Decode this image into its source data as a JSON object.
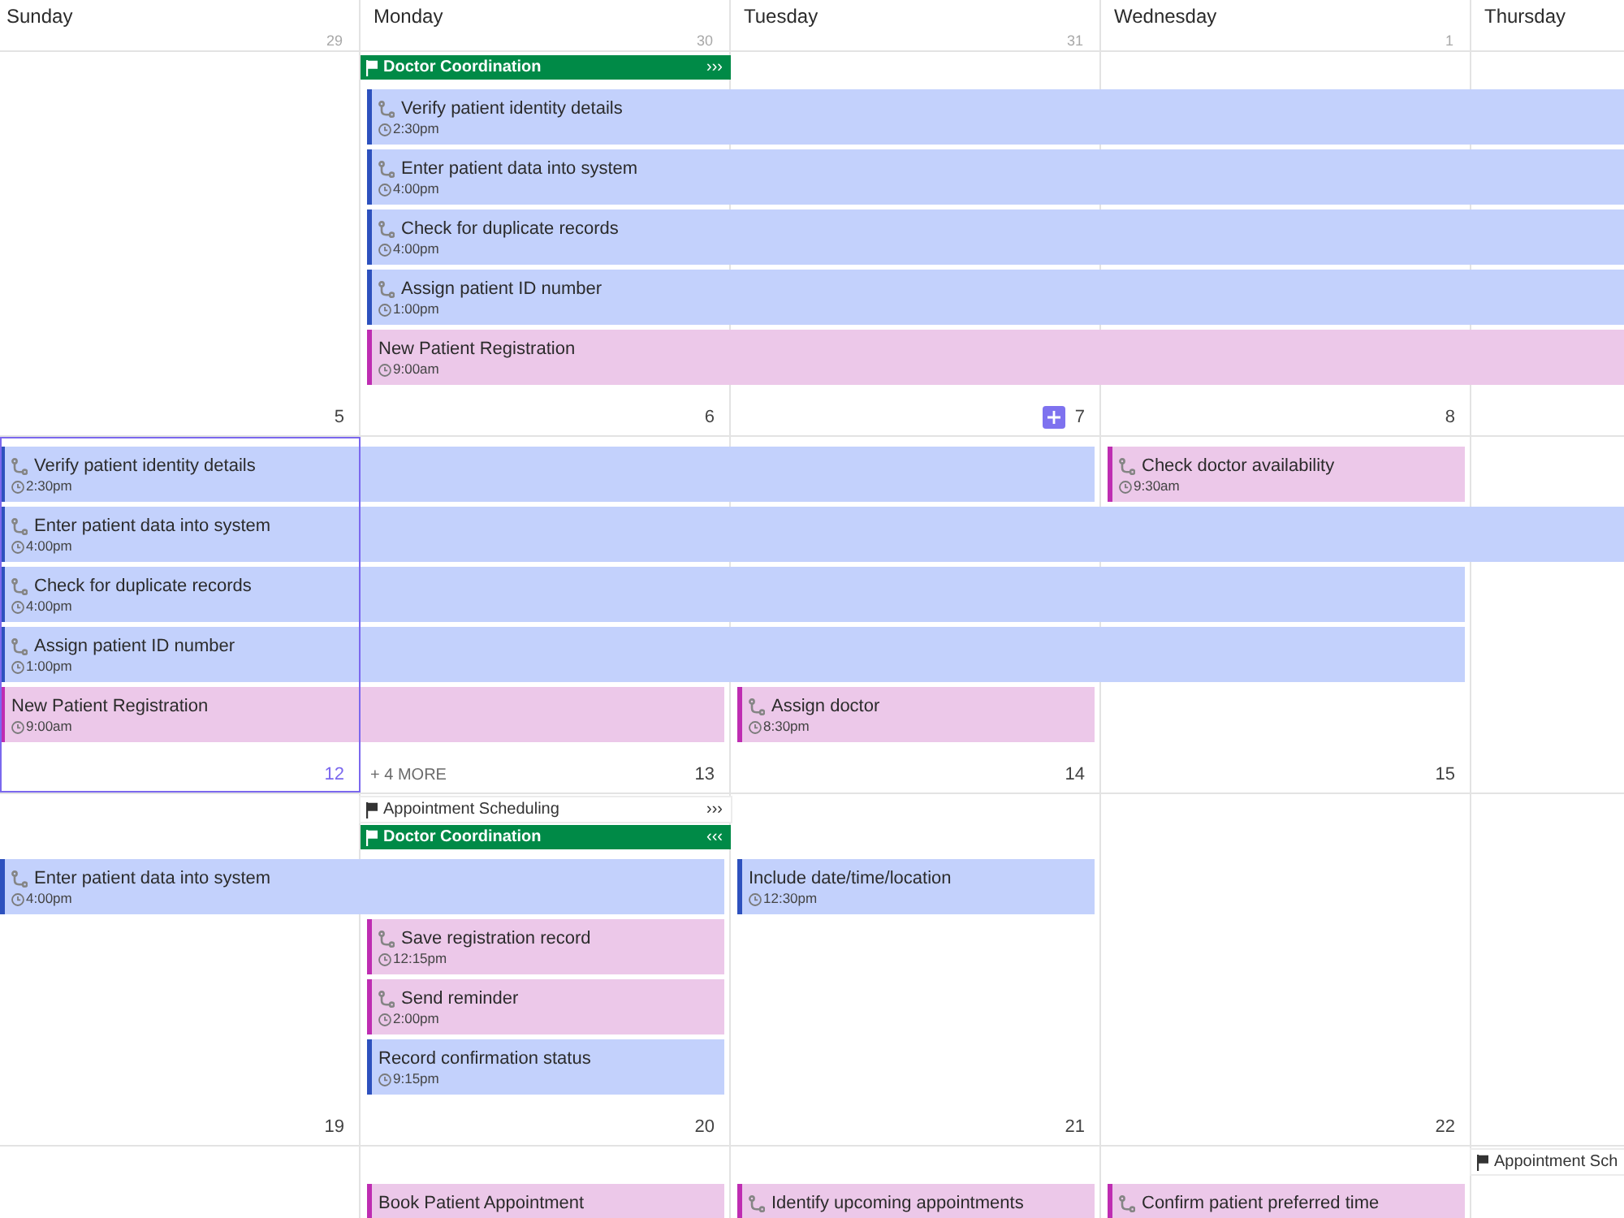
{
  "header": {
    "days": [
      {
        "name": "Sunday",
        "date": "29"
      },
      {
        "name": "Monday",
        "date": "30"
      },
      {
        "name": "Tuesday",
        "date": "31"
      },
      {
        "name": "Wednesday",
        "date": "1"
      },
      {
        "name": "Thursday"
      }
    ]
  },
  "weeks": [
    {
      "cells": [
        {
          "date": "5",
          "selected": false,
          "add_button": false
        },
        {
          "date": "6",
          "selected": false,
          "add_button": false
        },
        {
          "date": "7",
          "selected": false,
          "add_button": true
        },
        {
          "date": "8",
          "selected": false,
          "add_button": false
        }
      ],
      "lanes": [
        [
          {
            "kind": "empty"
          },
          {
            "kind": "milestone",
            "title": "Doctor Coordination",
            "arrows": "›››",
            "color": "#008a47"
          }
        ],
        [
          {
            "kind": "empty"
          },
          {
            "kind": "task",
            "title": "Verify patient identity details",
            "time": "2:30pm",
            "route_icon": true,
            "color": "#c3d1fc"
          },
          {
            "kind": "continued"
          },
          {
            "kind": "continued"
          },
          {
            "kind": "continued"
          }
        ],
        [
          {
            "kind": "empty"
          },
          {
            "kind": "task",
            "title": "Enter patient data into system",
            "time": "4:00pm",
            "route_icon": true,
            "color": "#c3d1fc"
          },
          {
            "kind": "continued"
          },
          {
            "kind": "continued"
          },
          {
            "kind": "continued"
          }
        ],
        [
          {
            "kind": "empty"
          },
          {
            "kind": "task",
            "title": "Check for duplicate records",
            "time": "4:00pm",
            "route_icon": true,
            "color": "#c3d1fc"
          },
          {
            "kind": "continued"
          },
          {
            "kind": "continued"
          },
          {
            "kind": "continued"
          }
        ],
        [
          {
            "kind": "empty"
          },
          {
            "kind": "task",
            "title": "Assign patient ID number",
            "time": "1:00pm",
            "route_icon": true,
            "color": "#c3d1fc"
          },
          {
            "kind": "continued"
          },
          {
            "kind": "continued"
          },
          {
            "kind": "continued"
          }
        ],
        [
          {
            "kind": "empty"
          },
          {
            "kind": "task",
            "title": "New Patient Registration",
            "time": "9:00am",
            "route_icon": false,
            "color": "#ecc8e9"
          },
          {
            "kind": "continued"
          },
          {
            "kind": "continued"
          },
          {
            "kind": "continued"
          }
        ]
      ]
    },
    {
      "cells": [
        {
          "date": "12",
          "selected": true,
          "add_button": false
        },
        {
          "date": "13",
          "more": "+ 4 MORE",
          "selected": false,
          "add_button": false
        },
        {
          "date": "14",
          "selected": false,
          "add_button": false
        },
        {
          "date": "15",
          "selected": false,
          "add_button": false
        }
      ],
      "lanes": [
        [
          {
            "kind": "task",
            "title": "Verify patient identity details",
            "time": "2:30pm",
            "route_icon": true,
            "color": "#c3d1fc"
          },
          {
            "kind": "continued"
          },
          {
            "kind": "continued"
          },
          {
            "kind": "task",
            "title": "Check doctor availability",
            "time": "9:30am",
            "route_icon": true,
            "color": "#ecc8e9"
          }
        ],
        [
          {
            "kind": "task",
            "title": "Enter patient data into system",
            "time": "4:00pm",
            "route_icon": true,
            "color": "#c3d1fc"
          },
          {
            "kind": "continued"
          },
          {
            "kind": "continued"
          },
          {
            "kind": "continued"
          },
          {
            "kind": "continued"
          }
        ],
        [
          {
            "kind": "task",
            "title": "Check for duplicate records",
            "time": "4:00pm",
            "route_icon": true,
            "color": "#c3d1fc"
          },
          {
            "kind": "continued"
          },
          {
            "kind": "continued"
          },
          {
            "kind": "continued"
          }
        ],
        [
          {
            "kind": "task",
            "title": "Assign patient ID number",
            "time": "1:00pm",
            "route_icon": true,
            "color": "#c3d1fc"
          },
          {
            "kind": "continued"
          },
          {
            "kind": "continued"
          },
          {
            "kind": "continued"
          }
        ],
        [
          {
            "kind": "task",
            "title": "New Patient Registration",
            "time": "9:00am",
            "route_icon": false,
            "color": "#ecc8e9"
          },
          {
            "kind": "continued"
          },
          {
            "kind": "task",
            "title": "Assign doctor",
            "time": "8:30pm",
            "route_icon": true,
            "color": "#ecc8e9"
          }
        ]
      ]
    },
    {
      "cells": [
        {
          "date": "19",
          "selected": false,
          "add_button": false
        },
        {
          "date": "20",
          "selected": false,
          "add_button": false
        },
        {
          "date": "21",
          "selected": false,
          "add_button": false
        },
        {
          "date": "22",
          "selected": false,
          "add_button": false
        }
      ],
      "lanes": [
        [
          {
            "kind": "empty"
          },
          {
            "kind": "milestone",
            "title": "Appointment Scheduling",
            "arrows": "›››",
            "color": "#ffffff"
          }
        ],
        [
          {
            "kind": "empty"
          },
          {
            "kind": "milestone",
            "title": "Doctor Coordination",
            "arrows": "‹‹‹",
            "color": "#008a47"
          }
        ],
        [
          {
            "kind": "task",
            "title": "Enter patient data into system",
            "time": "4:00pm",
            "route_icon": true,
            "color": "#c3d1fc"
          },
          {
            "kind": "continued"
          },
          {
            "kind": "task",
            "title": "Include date/time/location",
            "time": "12:30pm",
            "route_icon": false,
            "color": "#c3d1fc"
          }
        ],
        [
          {
            "kind": "empty"
          },
          {
            "kind": "task",
            "title": "Save registration record",
            "time": "12:15pm",
            "route_icon": true,
            "color": "#ecc8e9"
          }
        ],
        [
          {
            "kind": "empty"
          },
          {
            "kind": "task",
            "title": "Send reminder",
            "time": "2:00pm",
            "route_icon": true,
            "color": "#ecc8e9"
          }
        ],
        [
          {
            "kind": "empty"
          },
          {
            "kind": "task",
            "title": "Record confirmation status",
            "time": "9:15pm",
            "route_icon": false,
            "color": "#c3d1fc"
          }
        ]
      ]
    },
    {
      "lanes": [
        [
          {
            "kind": "empty"
          },
          {
            "kind": "empty"
          },
          {
            "kind": "empty"
          },
          {
            "kind": "empty"
          },
          {
            "kind": "milestone",
            "title": "Appointment Sch",
            "color": "#ffffff"
          }
        ],
        [
          {
            "kind": "empty"
          },
          {
            "kind": "task",
            "title": "Book Patient Appointment",
            "route_icon": false,
            "color": "#ecc8e9"
          },
          {
            "kind": "task",
            "title": "Identify upcoming appointments",
            "route_icon": true,
            "color": "#ecc8e9"
          },
          {
            "kind": "task",
            "title": "Confirm patient preferred time",
            "route_icon": true,
            "color": "#ecc8e9"
          }
        ]
      ]
    }
  ]
}
